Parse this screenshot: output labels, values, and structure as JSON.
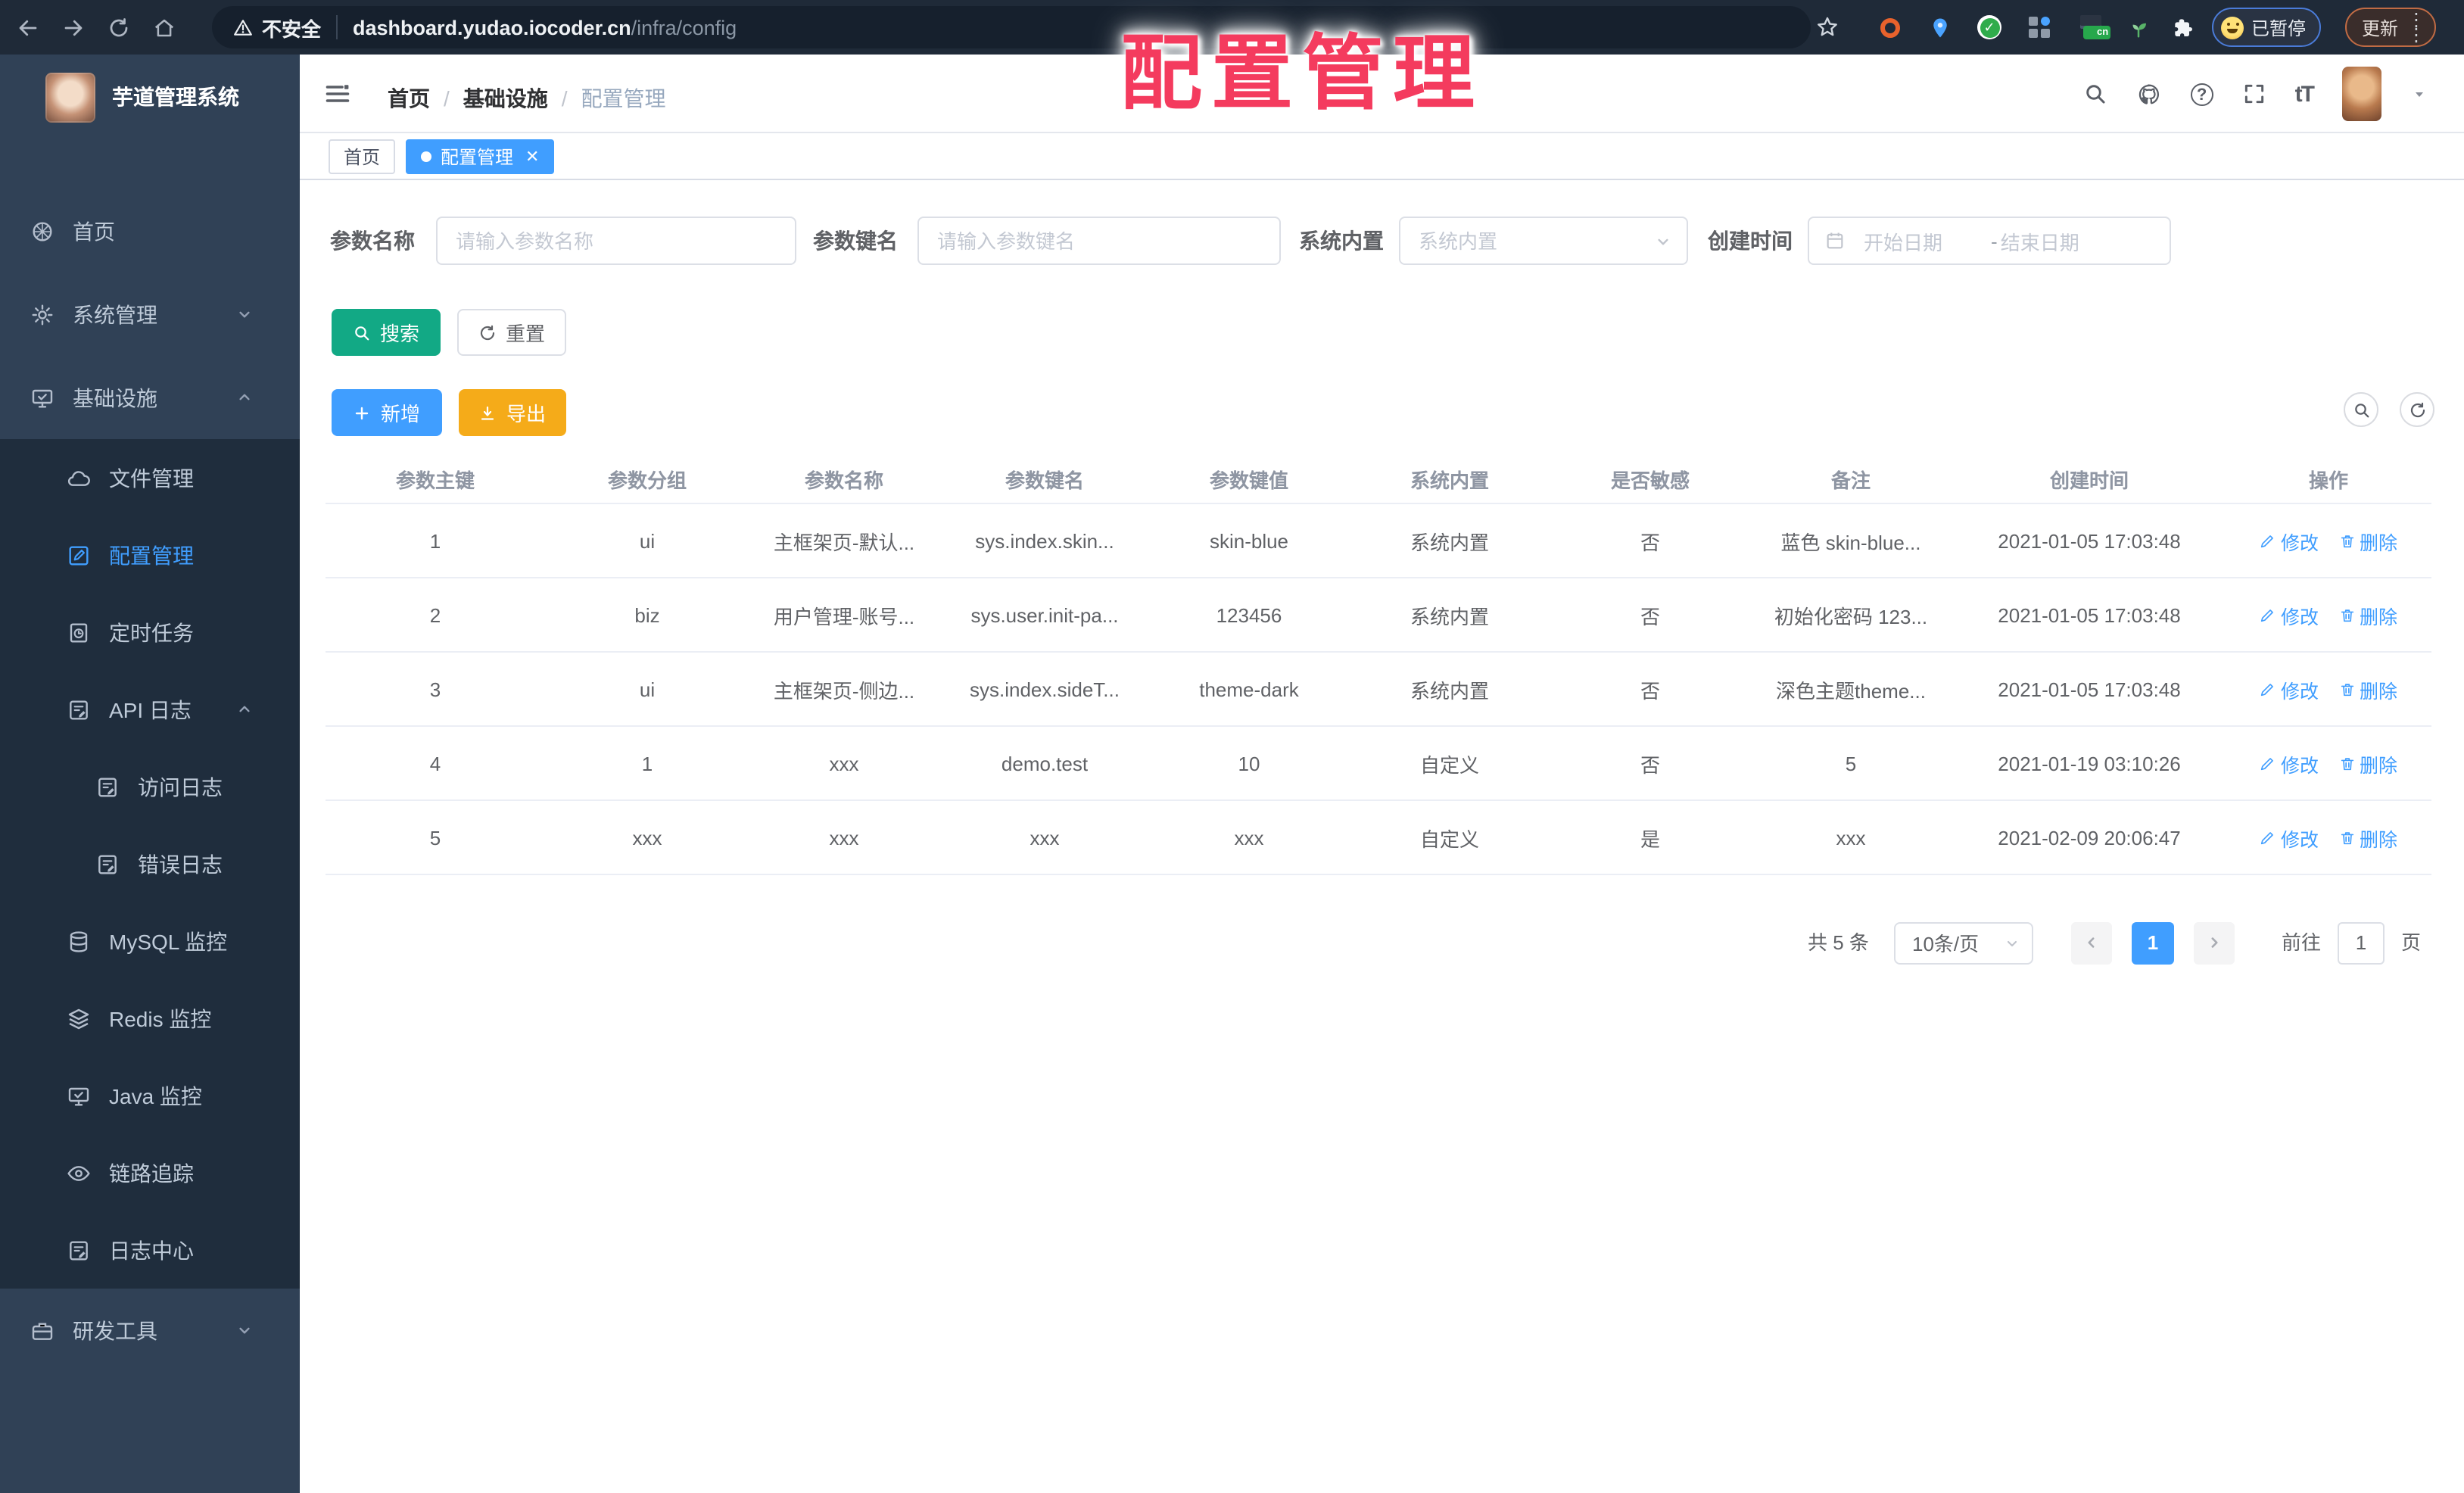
{
  "overlay": {
    "title": "配置管理"
  },
  "browser": {
    "security_label": "不安全",
    "url_host": "dashboard.yudao.iocoder.cn",
    "url_path": "/infra/config",
    "cn_badge": "cn",
    "paused_label": "已暂停",
    "update_label": "更新"
  },
  "sidebar": {
    "app_title": "芋道管理系统",
    "items": [
      {
        "label": "首页"
      },
      {
        "label": "系统管理"
      },
      {
        "label": "基础设施"
      },
      {
        "label": "文件管理"
      },
      {
        "label": "配置管理"
      },
      {
        "label": "定时任务"
      },
      {
        "label": "API 日志"
      },
      {
        "label": "访问日志"
      },
      {
        "label": "错误日志"
      },
      {
        "label": "MySQL 监控"
      },
      {
        "label": "Redis 监控"
      },
      {
        "label": "Java 监控"
      },
      {
        "label": "链路追踪"
      },
      {
        "label": "日志中心"
      },
      {
        "label": "研发工具"
      }
    ]
  },
  "navbar": {
    "breadcrumb": [
      "首页",
      "基础设施",
      "配置管理"
    ]
  },
  "tags": [
    {
      "label": "首页"
    },
    {
      "label": "配置管理"
    }
  ],
  "filters": {
    "name_label": "参数名称",
    "name_placeholder": "请输入参数名称",
    "key_label": "参数键名",
    "key_placeholder": "请输入参数键名",
    "builtin_label": "系统内置",
    "builtin_placeholder": "系统内置",
    "date_label": "创建时间",
    "date_start": "开始日期",
    "date_separator": "-",
    "date_end": "结束日期",
    "search_label": "搜索",
    "reset_label": "重置"
  },
  "toolbar": {
    "add_label": "新增",
    "export_label": "导出"
  },
  "table": {
    "headers": [
      "参数主键",
      "参数分组",
      "参数名称",
      "参数键名",
      "参数键值",
      "系统内置",
      "是否敏感",
      "备注",
      "创建时间",
      "操作"
    ],
    "edit_label": "修改",
    "delete_label": "删除",
    "rows": [
      {
        "c": [
          "1",
          "ui",
          "主框架页-默认...",
          "sys.index.skin...",
          "skin-blue",
          "系统内置",
          "否",
          "蓝色 skin-blue...",
          "2021-01-05 17:03:48"
        ]
      },
      {
        "c": [
          "2",
          "biz",
          "用户管理-账号...",
          "sys.user.init-pa...",
          "123456",
          "系统内置",
          "否",
          "初始化密码 123...",
          "2021-01-05 17:03:48"
        ]
      },
      {
        "c": [
          "3",
          "ui",
          "主框架页-侧边...",
          "sys.index.sideT...",
          "theme-dark",
          "系统内置",
          "否",
          "深色主题theme...",
          "2021-01-05 17:03:48"
        ]
      },
      {
        "c": [
          "4",
          "1",
          "xxx",
          "demo.test",
          "10",
          "自定义",
          "否",
          "5",
          "2021-01-19 03:10:26"
        ]
      },
      {
        "c": [
          "5",
          "xxx",
          "xxx",
          "xxx",
          "xxx",
          "自定义",
          "是",
          "xxx",
          "2021-02-09 20:06:47"
        ]
      }
    ]
  },
  "pagination": {
    "total_label": "共 5 条",
    "page_size_label": "10条/页",
    "current_page": "1",
    "goto_label": "前往",
    "goto_value": "1",
    "page_unit_label": "页"
  },
  "colors": {
    "accent": "#409eff",
    "success": "#12a985",
    "warning": "#f5ab19",
    "sidebar": "#304156",
    "submenu": "#1f2d3d",
    "overlay_red": "#f43b5e"
  }
}
